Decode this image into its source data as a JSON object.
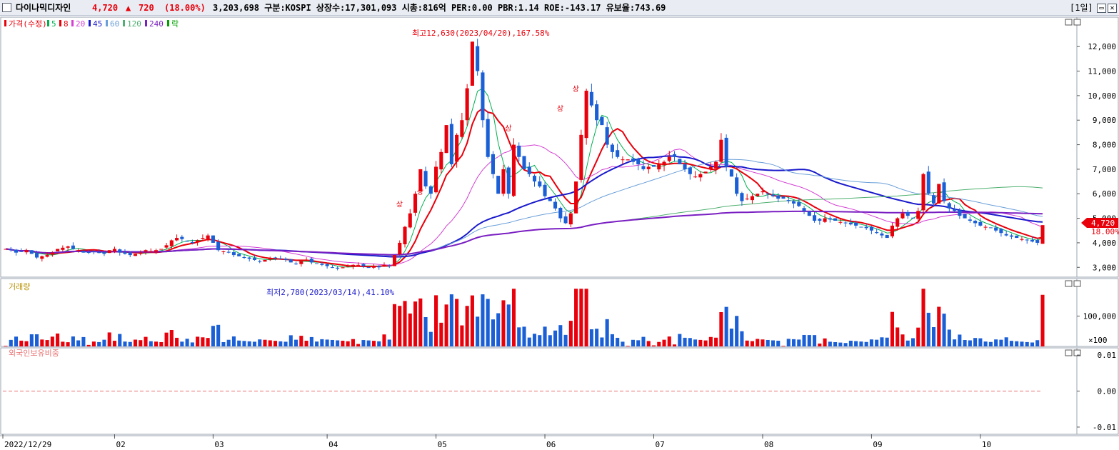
{
  "header": {
    "stock_name": "다이나믹디자인",
    "price": "4,720",
    "arrow": "▲",
    "change": "720",
    "change_rate": "(18.00%)",
    "info": "3,203,698  구분:KOSPI  상장수:17,301,093  시총:816억  PER:0.00  PBR:1.14  ROE:-143.17  유보율:743.69",
    "period": "[1일]",
    "colors": {
      "up": "#e8000b",
      "down": "#1a5fd6",
      "panel_bg": "#e9edf3"
    }
  },
  "price_panel": {
    "legend": [
      {
        "label": "가격(수정)",
        "color": "#e8000b"
      },
      {
        "label": "5",
        "color": "#00b050"
      },
      {
        "label": "8",
        "color": "#e8000b"
      },
      {
        "label": "20",
        "color": "#d43fd4"
      },
      {
        "label": "45",
        "color": "#1a1acc"
      },
      {
        "label": "60",
        "color": "#6a9fd8"
      },
      {
        "label": "120",
        "color": "#4fb06f"
      },
      {
        "label": "240",
        "color": "#7a1fc2"
      },
      {
        "label": "락",
        "color": "#00a000"
      }
    ],
    "annotation_high": "최고12,630(2023/04/20),167.58%",
    "annotation_low": "최저2,780(2023/03/14),41.10%",
    "limit_up_marker": "상",
    "current_price_tag": "4,720",
    "current_rate_tag": "18.00%"
  },
  "volume_panel": {
    "legend": "거래량",
    "unit_label": "×100"
  },
  "foreign_panel": {
    "legend": "외국인보유비중"
  },
  "x_axis": {
    "labels": [
      "2022/12/29",
      "02",
      "03",
      "04",
      "05",
      "06",
      "07",
      "08",
      "09",
      "10"
    ]
  },
  "chart_data": [
    {
      "type": "candlestick",
      "title": "",
      "yticks": [
        "3,000",
        "4,000",
        "5,000",
        "6,000",
        "7,000",
        "8,000",
        "9,000",
        "10,000",
        "11,000",
        "12,000"
      ],
      "ylim": [
        2600,
        13200
      ],
      "high": {
        "value": 12630,
        "date": "2023/04/20"
      },
      "low": {
        "value": 2780,
        "date": "2023/03/14"
      },
      "last_close": 4720,
      "x_months": [
        "2022/12/29",
        "02",
        "03",
        "04",
        "05",
        "06",
        "07",
        "08",
        "09",
        "10"
      ],
      "closes": [
        3750,
        3700,
        3600,
        3650,
        3700,
        3550,
        3400,
        3450,
        3500,
        3600,
        3750,
        3800,
        3850,
        3750,
        3700,
        3600,
        3600,
        3650,
        3600,
        3550,
        3700,
        3750,
        3600,
        3550,
        3500,
        3550,
        3600,
        3700,
        3650,
        3700,
        3750,
        3900,
        4100,
        4200,
        4150,
        4050,
        4000,
        4100,
        4200,
        4300,
        4000,
        3700,
        3650,
        3600,
        3500,
        3450,
        3400,
        3350,
        3300,
        3250,
        3300,
        3350,
        3400,
        3350,
        3300,
        3200,
        3150,
        3250,
        3300,
        3200,
        3150,
        3100,
        3050,
        3000,
        2950,
        3000,
        3050,
        3100,
        3100,
        3050,
        3000,
        3050,
        3000,
        3100,
        3050,
        3500,
        4000,
        4650,
        5200,
        6000,
        7000,
        6300,
        6000,
        7100,
        7700,
        8800,
        7200,
        8400,
        9000,
        10300,
        12200,
        11000,
        9000,
        7500,
        6800,
        6000,
        7000,
        6000,
        8000,
        7500,
        7000,
        6800,
        6500,
        6300,
        5900,
        5700,
        5400,
        5000,
        4800,
        5200,
        6500,
        8400,
        10200,
        9600,
        9000,
        8800,
        8000,
        7700,
        7500,
        7400,
        7400,
        7300,
        7200,
        7000,
        7100,
        7100,
        7200,
        7300,
        7500,
        7500,
        7200,
        7000,
        6800,
        6700,
        6800,
        6900,
        7100,
        7300,
        8200,
        7100,
        6700,
        6000,
        5700,
        5800,
        5900,
        6000,
        6100,
        6000,
        5900,
        5800,
        5800,
        5700,
        5600,
        5500,
        5300,
        5100,
        4900,
        4900,
        5000,
        4950,
        4900,
        4850,
        4800,
        4750,
        4700,
        4650,
        4600,
        4500,
        4400,
        4300,
        4200,
        4700,
        5000,
        5200,
        5100,
        5000,
        5300,
        6800,
        6000,
        5600,
        6400,
        5700,
        5400,
        5300,
        5100,
        5000,
        4900,
        4800,
        4700,
        4650,
        4600,
        4500,
        4400,
        4300,
        4250,
        4200,
        4150,
        4100,
        4050,
        4000,
        4720
      ],
      "volume_unit": "×100",
      "volume_ylim": [
        0,
        200000
      ],
      "volume_ticks": [
        "100,000"
      ]
    },
    {
      "type": "line",
      "title": "외국인보유비중",
      "yticks": [
        "0.01",
        "0.00",
        "-0.01"
      ],
      "ylim": [
        -0.012,
        0.012
      ],
      "values": [
        0,
        0
      ]
    }
  ]
}
